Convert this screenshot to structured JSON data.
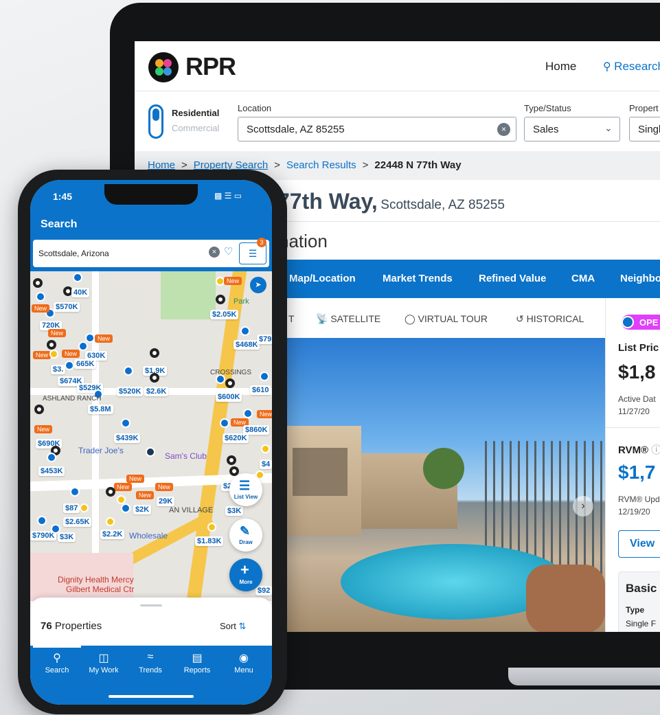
{
  "desktop": {
    "logo": "RPR",
    "nav": {
      "home": "Home",
      "research": "Research"
    },
    "search": {
      "mode_active": "Residential",
      "mode_inactive": "Commercial",
      "location_label": "Location",
      "location_value": "Scottsdale, AZ 85255",
      "type_label": "Type/Status",
      "type_value": "Sales",
      "property_label": "Propert",
      "property_value": "Singl"
    },
    "breadcrumb": [
      "Home",
      "Property Search",
      "Search Results",
      "22448 N 77th Way"
    ],
    "address_street": "77th Way,",
    "address_city": "Scottsdale, AZ 85255",
    "section_heading": "nation",
    "tabs": [
      "Map/Location",
      "Market Trends",
      "Refined Value",
      "CMA",
      "Neighbo"
    ],
    "view_tabs": [
      "T",
      "SATELLITE",
      "VIRTUAL TOUR",
      "HISTORICAL"
    ],
    "listing": {
      "status": "OPE",
      "list_price_label": "List Pric",
      "list_price": "$1,8",
      "active_date_label": "Active Dat",
      "active_date": "11/27/20",
      "rvm_label": "RVM®",
      "rvm_value": "$1,7",
      "rvm_updated_label": "RVM® Upd",
      "rvm_updated": "12/19/20",
      "view_button": "View",
      "basic_heading": "Basic",
      "type_label": "Type",
      "type_value": "Single F"
    },
    "colors": {
      "brand_blue": "#0b73c9",
      "status_purple": "#e040fb"
    }
  },
  "phone": {
    "time": "1:45",
    "title": "Search",
    "search_value": "Scottsdale, Arizona",
    "filter_count": "3",
    "map_prices": [
      "40K",
      "$570K",
      "720K",
      "630K",
      "665K",
      "$3.",
      "$674K",
      "$529K",
      "$520K",
      "$2.6K",
      "$1.9K",
      "$5.8M",
      "$439K",
      "$690K",
      "$453K",
      "$87",
      "$2.65K",
      "$2.2K",
      "$3K",
      "$790K",
      "29K",
      "$2K",
      "$2.05K",
      "$468K",
      "$79",
      "$610",
      "$600K",
      "$860K",
      "$620K",
      "$4",
      "$3K",
      "$1.83K",
      "$92",
      "$2"
    ],
    "poi": [
      "Trader Joe's",
      "Sam's Club",
      "Wholesale",
      "Dignity Health Mercy",
      "Gilbert Medical Ctr",
      "ASHLAND RANCH",
      "CROSSINGS",
      "AN VILLAGE",
      "Park"
    ],
    "fabs": {
      "list": "List View",
      "draw": "Draw",
      "more": "More"
    },
    "count": "76",
    "count_label": "Properties",
    "sort": "Sort",
    "bottom_nav": [
      "Search",
      "My Work",
      "Trends",
      "Reports",
      "Menu"
    ]
  }
}
